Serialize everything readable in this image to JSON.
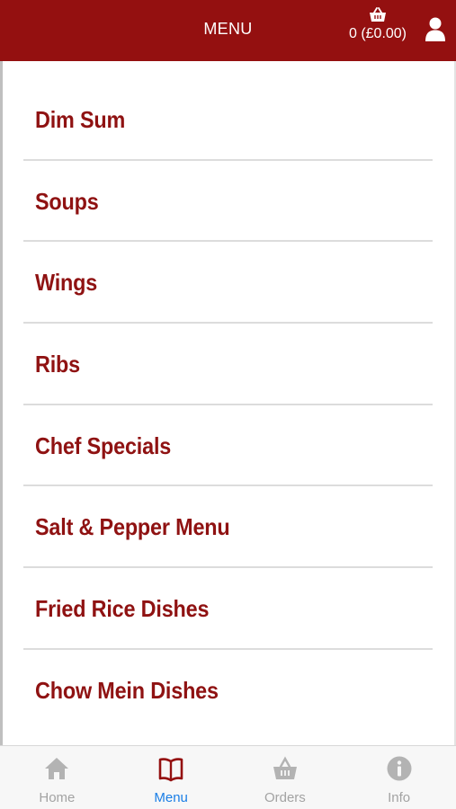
{
  "header": {
    "title": "MENU",
    "basket_text": "0 (£0.00)",
    "basket_icon": "basket-icon",
    "user_icon": "user-icon"
  },
  "menu": {
    "items": [
      {
        "label": "Dim Sum"
      },
      {
        "label": "Soups"
      },
      {
        "label": "Wings"
      },
      {
        "label": "Ribs"
      },
      {
        "label": "Chef Specials"
      },
      {
        "label": "Salt & Pepper Menu"
      },
      {
        "label": "Fried Rice Dishes"
      },
      {
        "label": "Chow Mein Dishes"
      }
    ]
  },
  "bottom_nav": {
    "tabs": [
      {
        "label": "Home",
        "icon": "home-icon"
      },
      {
        "label": "Menu",
        "icon": "book-icon",
        "active": true
      },
      {
        "label": "Orders",
        "icon": "basket-icon"
      },
      {
        "label": "Info",
        "icon": "info-icon"
      }
    ]
  },
  "colors": {
    "header_bg": "#941010",
    "item_text": "#8f1212",
    "active_tab": "#1a7ee6",
    "inactive_tab": "#a3a3a3"
  }
}
